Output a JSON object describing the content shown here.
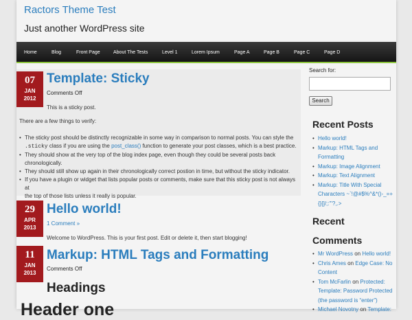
{
  "site": {
    "title": "Ractors Theme Test",
    "description": "Just another WordPress site"
  },
  "nav": [
    "Home",
    "Blog",
    "Front Page",
    "About The Tests",
    "Level 1",
    "Lorem Ipsum",
    "Page A",
    "Page B",
    "Page C",
    "Page D"
  ],
  "colors": {
    "accent": "#2a7dbd",
    "date_badge": "#a21a1e",
    "nav_bg": "#222222",
    "nav_border": "#8ec63f"
  },
  "posts": [
    {
      "day": "07",
      "month": "JAN",
      "year": "2012",
      "title": "Template: Sticky",
      "meta": "Comments Off",
      "intro": "This is a sticky post.",
      "lead": "There are a few things to verify:",
      "bullets": [
        {
          "lines": [
            "The sticky post should be distinctly recognizable in some way in comparison to normal posts. You can style the",
            {
              "pre": "",
              "code": ".sticky",
              "mid": " class if you are using the ",
              "link": "post_class()",
              "post": " function to generate your post classes, which is a best practice."
            }
          ]
        },
        {
          "lines": [
            "They should show at the very top of the blog index page, even though they could be several posts back",
            "chronologically."
          ]
        },
        {
          "lines": [
            "They should still show up again in their chronologically correct postion in time, but without the sticky indicator."
          ]
        },
        {
          "lines": [
            "If you have a plugin or widget that lists popular posts or comments, make sure that this sticky post is not always at",
            "the top of those lists unless it really is popular."
          ]
        }
      ]
    },
    {
      "day": "29",
      "month": "APR",
      "year": "2013",
      "title": "Hello world!",
      "meta": "1 Comment »",
      "body": "Welcome to WordPress. This is your first post. Edit or delete it, then start blogging!"
    },
    {
      "day": "11",
      "month": "JAN",
      "year": "2013",
      "title": "Markup: HTML Tags and Formatting",
      "meta": "Comments Off",
      "h2": "Headings",
      "h1": "Header one"
    }
  ],
  "sidebar": {
    "search_label": "Search for:",
    "search_value": "",
    "search_button": "Search",
    "recent_posts_title": "Recent Posts",
    "recent_posts": [
      [
        "Hello world!"
      ],
      [
        "Markup: HTML Tags and",
        "Formatting"
      ],
      [
        "Markup: Image Alignment"
      ],
      [
        "Markup: Text Alignment"
      ],
      [
        "Markup: Title With Special",
        "Characters ~`!@#$%^&*()-_=+",
        "{}[]/;:'\"?,.>"
      ]
    ],
    "recent_comments_title_1": "Recent",
    "recent_comments_title_2": "Comments",
    "recent_comments": [
      {
        "author": "Mr WordPress",
        "on": " on ",
        "post_lines": [
          "Hello world!"
        ]
      },
      {
        "author": "Chris Ames",
        "on": " on ",
        "post_lines": [
          "Edge Case: No",
          "Content"
        ]
      },
      {
        "author": "Tom McFarlin",
        "on": " on ",
        "post_lines": [
          "Protected:",
          "Template: Password Protected",
          "(the password is “enter”)"
        ]
      },
      {
        "author": "Michael Novotny",
        "on": " on ",
        "post_lines": [
          "Template:"
        ]
      }
    ]
  }
}
